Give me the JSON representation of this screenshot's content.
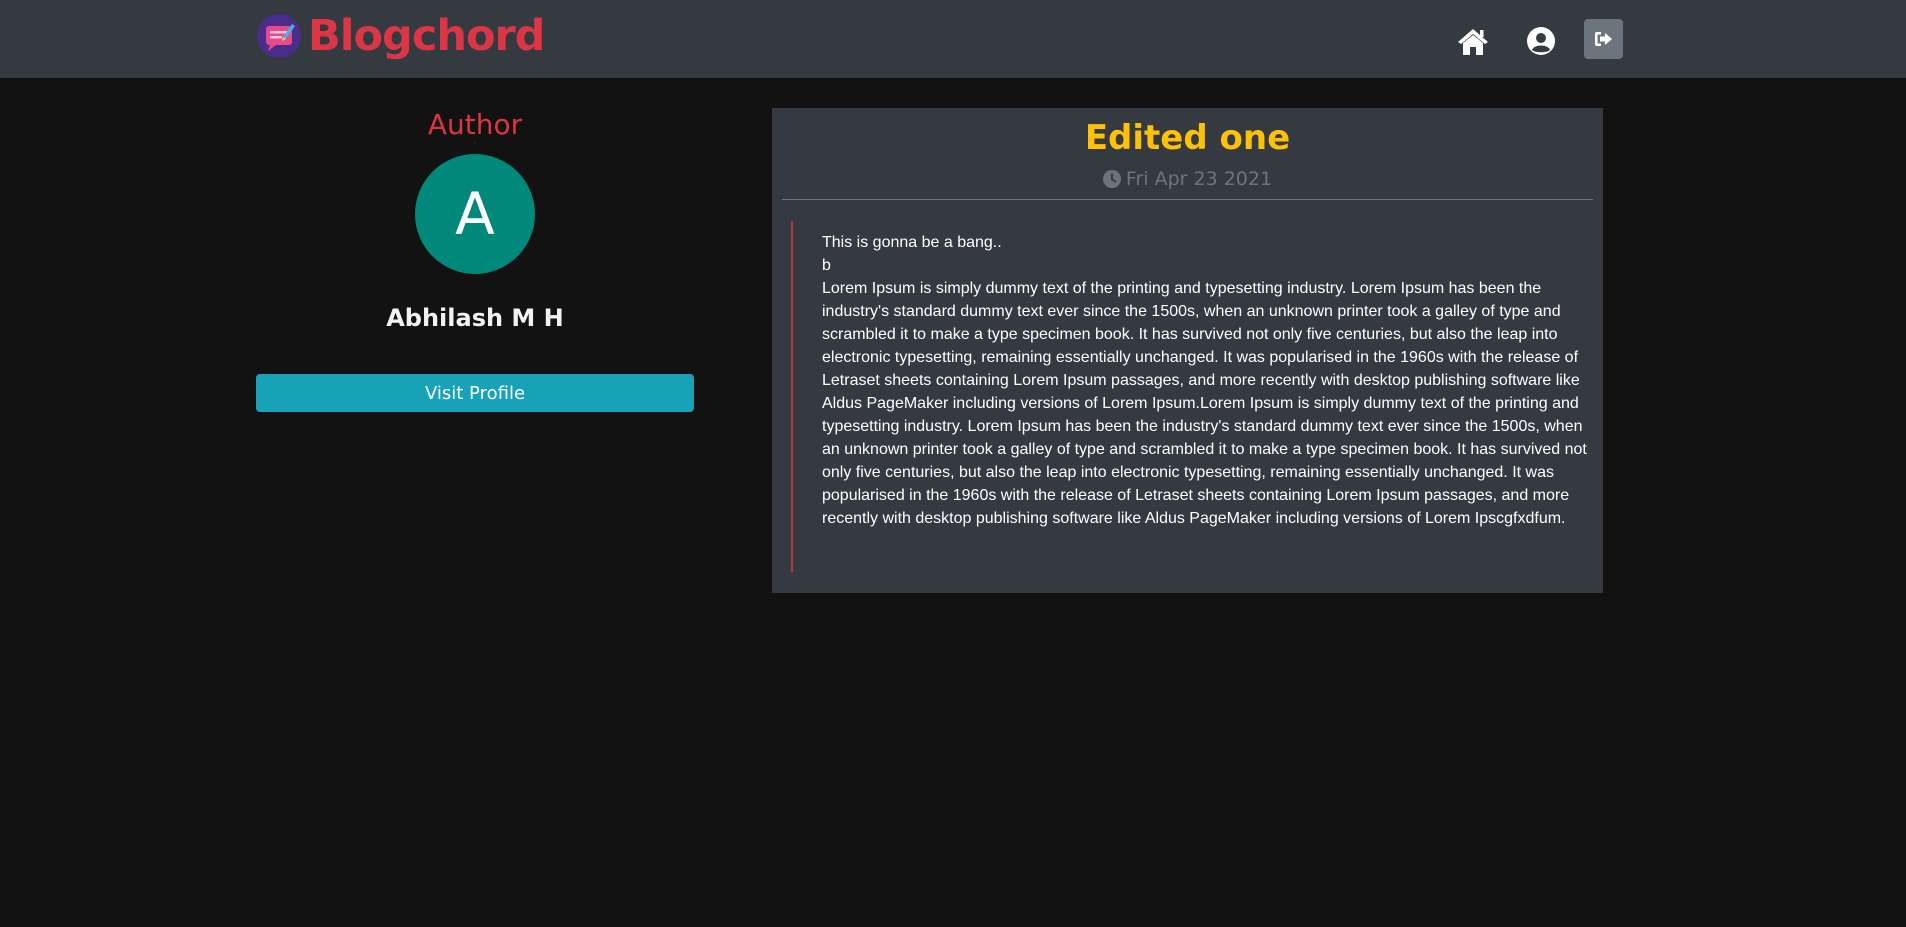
{
  "navbar": {
    "brand_name": "Blogchord",
    "icons": {
      "logo": "blogchord-logo-icon",
      "home": "home-icon",
      "profile": "user-circle-icon",
      "logout": "sign-out-icon"
    }
  },
  "author_panel": {
    "label": "Author",
    "avatar_letter": "A",
    "name": "Abhilash M H",
    "visit_button_label": "Visit Profile"
  },
  "post": {
    "title": "Edited one",
    "date": "Fri Apr 23 2021",
    "date_icon": "clock-icon",
    "body_lines": [
      "This is gonna be a bang..",
      "b",
      "Lorem Ipsum is simply dummy text of the printing and typesetting industry. Lorem Ipsum has been the industry's standard dummy text ever since the 1500s, when an unknown printer took a galley of type and scrambled it to make a type specimen book. It has survived not only five centuries, but also the leap into electronic typesetting, remaining essentially unchanged. It was popularised in the 1960s with the release of Letraset sheets containing Lorem Ipsum passages, and more recently with desktop publishing software like Aldus PageMaker including versions of Lorem Ipsum.Lorem Ipsum is simply dummy text of the printing and typesetting industry. Lorem Ipsum has been the industry's standard dummy text ever since the 1500s, when an unknown printer took a galley of type and scrambled it to make a type specimen book. It has survived not only five centuries, but also the leap into electronic typesetting, remaining essentially unchanged. It was popularised in the 1960s with the release of Letraset sheets containing Lorem Ipsum passages, and more recently with desktop publishing software like Aldus PageMaker including versions of Lorem Ipscgfxdfum."
    ]
  },
  "colors": {
    "page_background": "#121212",
    "navbar_background": "#343a40",
    "brand": "#dc3545",
    "title": "#ffc107",
    "button": "#17a2b8",
    "avatar": "#00897b",
    "muted": "#6c757d",
    "quote_border": "#b33a3a"
  }
}
